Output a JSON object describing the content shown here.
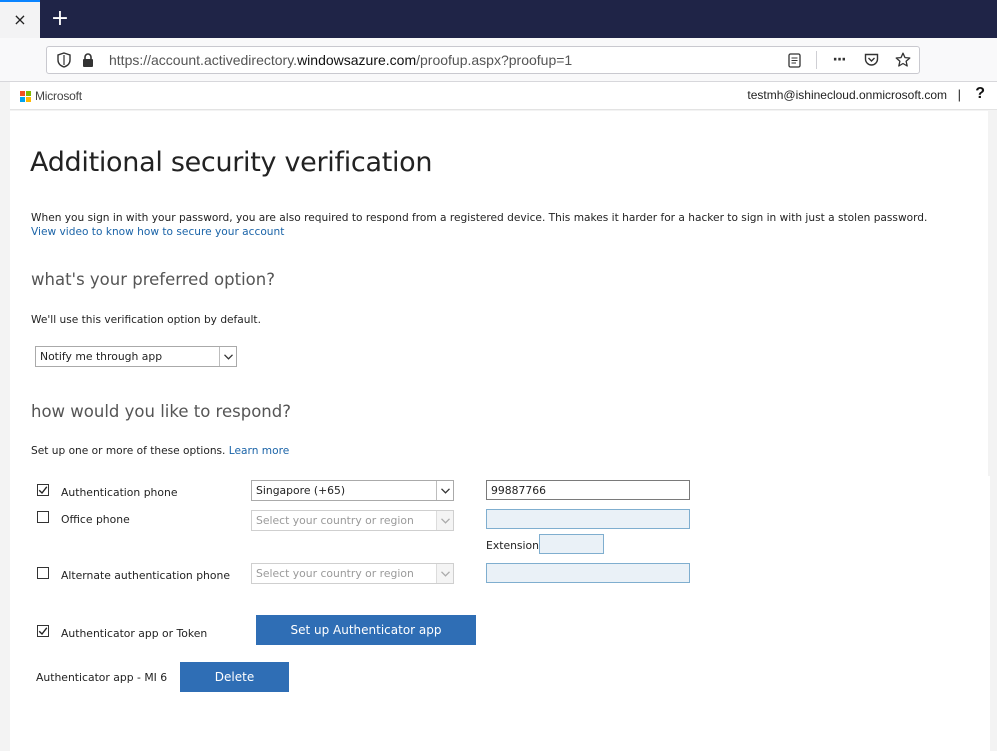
{
  "browser": {
    "tab_close_glyph": "×",
    "new_tab_glyph": "+",
    "url_prefix": "https://account.activedirectory.",
    "url_domain": "windowsazure.com",
    "url_suffix": "/proofup.aspx?proofup=1",
    "more_glyph": "···"
  },
  "header": {
    "brand": "Microsoft",
    "account": "testmh@ishinecloud.onmicrosoft.com",
    "separator": "|",
    "help": "?",
    "logo_colors": [
      "#f25022",
      "#7fba00",
      "#00a4ef",
      "#ffb900"
    ]
  },
  "page": {
    "title": "Additional security verification",
    "description": "When you sign in with your password, you are also required to respond from a registered device. This makes it harder for a hacker to sign in with just a stolen password.",
    "video_link": "View video to know how to secure your account",
    "preferred_heading": "what's your preferred option?",
    "preferred_desc": "We'll use this verification option by default.",
    "preferred_value": "Notify me through app",
    "respond_heading": "how would you like to respond?",
    "respond_desc": "Set up one or more of these options.",
    "learn_more": "Learn more"
  },
  "options": {
    "auth_phone": {
      "label": "Authentication phone",
      "checked": true,
      "country": "Singapore (+65)",
      "number": "99887766"
    },
    "office_phone": {
      "label": "Office phone",
      "checked": false,
      "country_placeholder": "Select your country or region",
      "extension_label": "Extension"
    },
    "alt_phone": {
      "label": "Alternate authentication phone",
      "checked": false,
      "country_placeholder": "Select your country or region"
    },
    "auth_app": {
      "label": "Authenticator app or Token",
      "checked": true,
      "setup_button": "Set up Authenticator app"
    },
    "device": {
      "label": "Authenticator app - MI 6",
      "delete_button": "Delete"
    }
  },
  "colors": {
    "link": "#1b64a8",
    "button": "#2f6eb5",
    "tabstrip": "#1f2447"
  }
}
